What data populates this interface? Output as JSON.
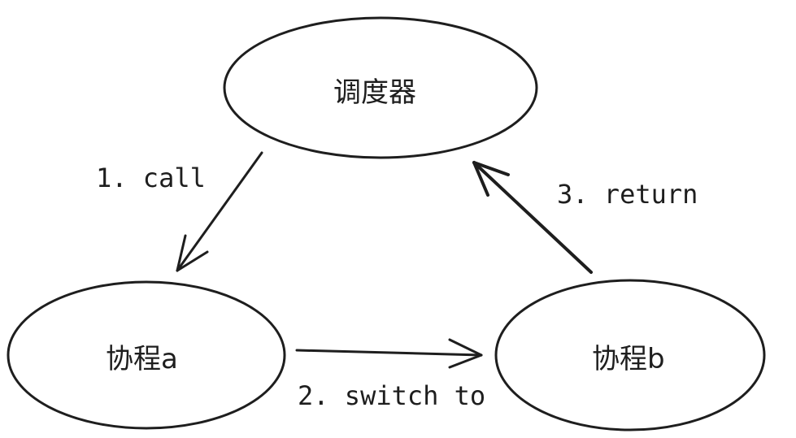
{
  "nodes": {
    "scheduler": "调度器",
    "coroutine_a": "协程a",
    "coroutine_b": "协程b"
  },
  "edges": {
    "call": "1. call",
    "switch": "2. switch to",
    "return": "3. return"
  }
}
